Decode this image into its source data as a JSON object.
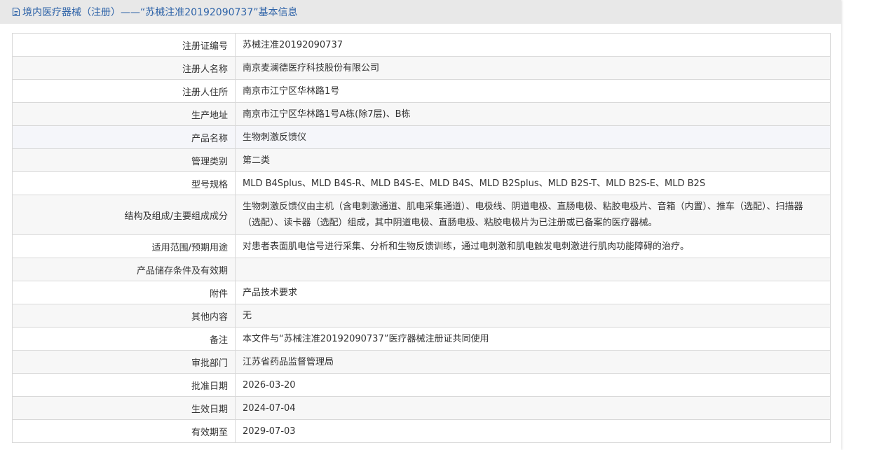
{
  "header": {
    "title": "境内医疗器械（注册）——“苏械注准20192090737”基本信息",
    "icon": "document-icon",
    "color": "#2e63a8"
  },
  "rows": [
    {
      "label": "注册证编号",
      "value": "苏械注准20192090737"
    },
    {
      "label": "注册人名称",
      "value": "南京麦澜德医疗科技股份有限公司"
    },
    {
      "label": "注册人住所",
      "value": "南京市江宁区华林路1号"
    },
    {
      "label": "生产地址",
      "value": "南京市江宁区华林路1号A栋(除7层)、B栋"
    },
    {
      "label": "产品名称",
      "value": "生物刺激反馈仪"
    },
    {
      "label": "管理类别",
      "value": "第二类"
    },
    {
      "label": "型号规格",
      "value": "MLD B4Splus、MLD B4S-R、MLD B4S-E、MLD B4S、MLD B2Splus、MLD B2S-T、MLD B2S-E、MLD B2S"
    },
    {
      "label": "结构及组成/主要组成成分",
      "value": "生物刺激反馈仪由主机（含电刺激通道、肌电采集通道）、电极线、阴道电极、直肠电极、粘胶电极片、音箱（内置）、推车（选配）、扫描器（选配）、读卡器（选配）组成，其中阴道电极、直肠电极、粘胶电极片为已注册或已备案的医疗器械。"
    },
    {
      "label": "适用范围/预期用途",
      "value": "对患者表面肌电信号进行采集、分析和生物反馈训练，通过电刺激和肌电触发电刺激进行肌肉功能障碍的治疗。"
    },
    {
      "label": "产品储存条件及有效期",
      "value": ""
    },
    {
      "label": "附件",
      "value": "产品技术要求"
    },
    {
      "label": "其他内容",
      "value": "无"
    },
    {
      "label": "备注",
      "value": "本文件与“苏械注准20192090737”医疗器械注册证共同使用"
    },
    {
      "label": "审批部门",
      "value": "江苏省药品监督管理局"
    },
    {
      "label": "批准日期",
      "value": "2026-03-20"
    },
    {
      "label": "生效日期",
      "value": "2024-07-04"
    },
    {
      "label": "有效期至",
      "value": "2029-07-03"
    }
  ]
}
